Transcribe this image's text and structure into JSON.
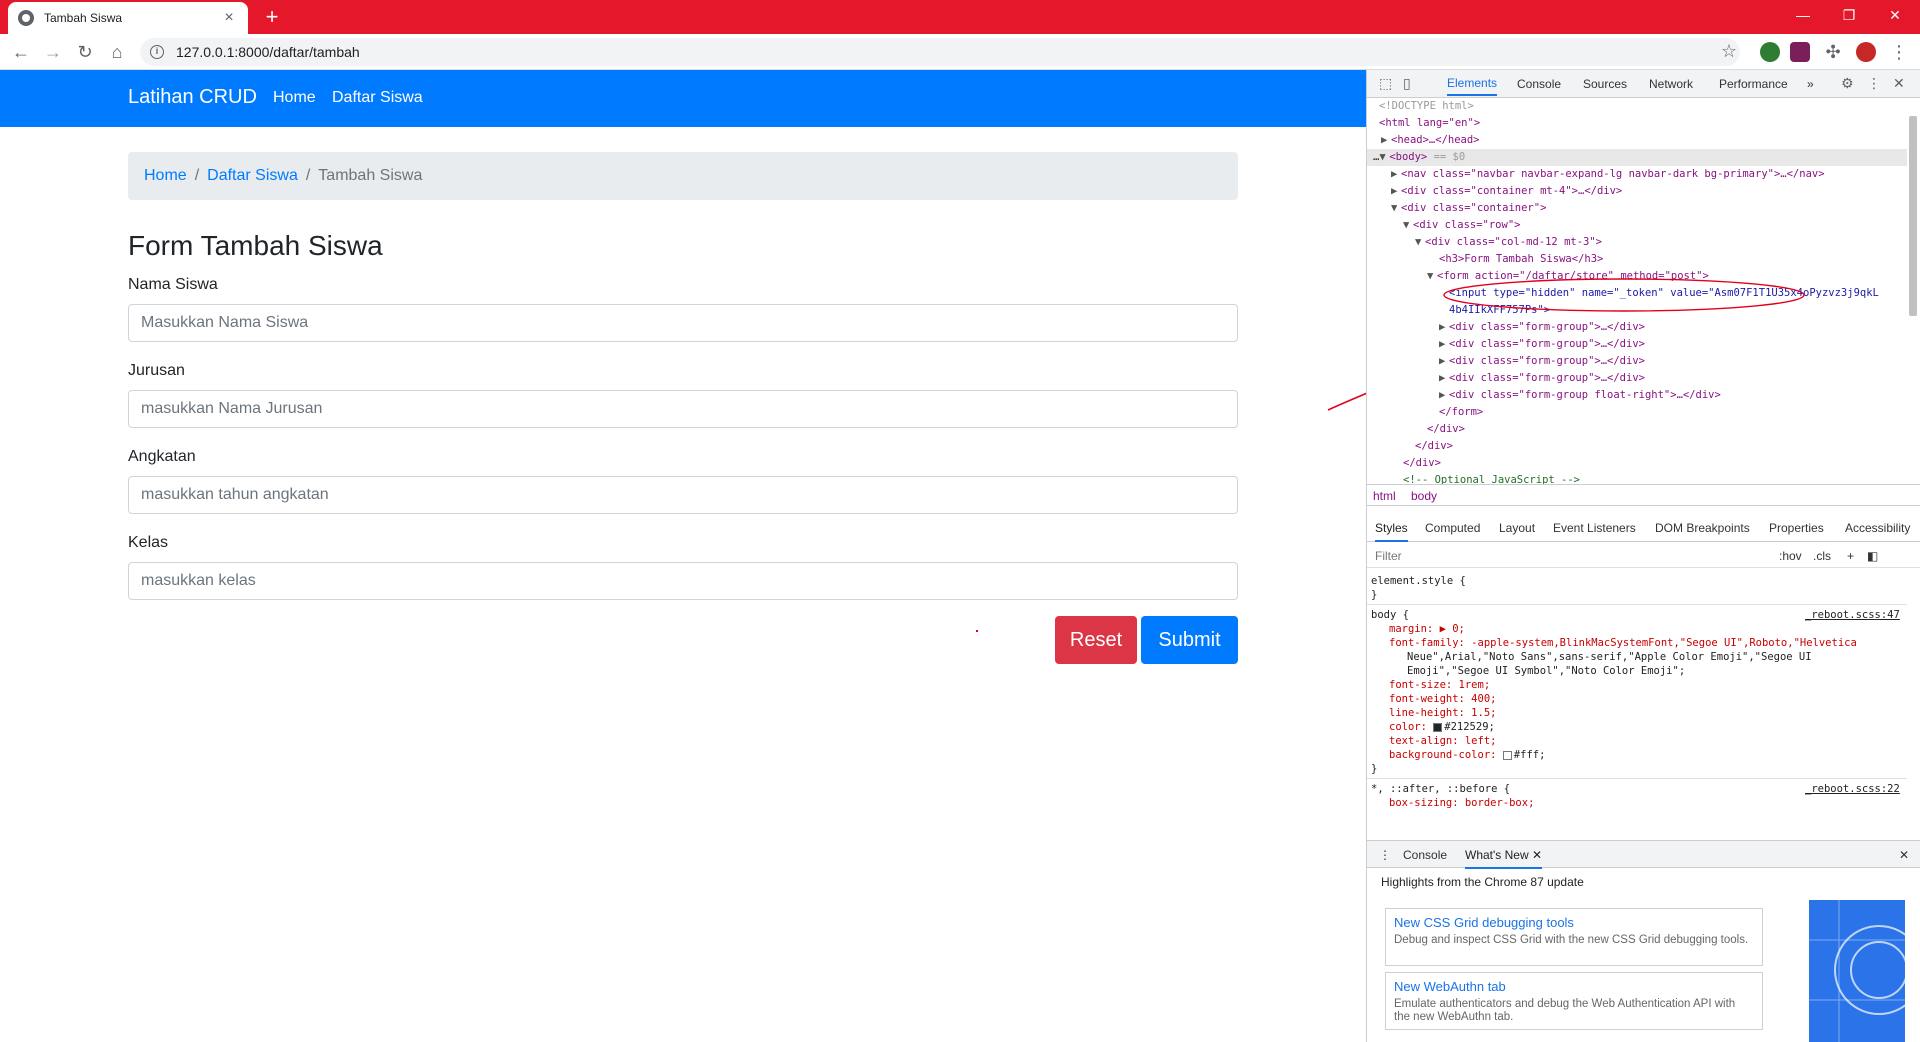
{
  "browser": {
    "tab_title": "Tambah Siswa",
    "new_tab": "+",
    "url": "127.0.0.1:8000/daftar/tambah",
    "controls": {
      "minimize": "—",
      "restore": "❐",
      "close": "✕"
    }
  },
  "navbar": {
    "brand": "Latihan CRUD",
    "links": [
      "Home",
      "Daftar Siswa"
    ]
  },
  "breadcrumb": {
    "items": [
      "Home",
      "Daftar Siswa"
    ],
    "separator": "/",
    "active": "Tambah Siswa"
  },
  "form": {
    "title": "Form Tambah Siswa",
    "fields": [
      {
        "label": "Nama Siswa",
        "placeholder": "Masukkan Nama Siswa"
      },
      {
        "label": "Jurusan",
        "placeholder": "masukkan Nama Jurusan"
      },
      {
        "label": "Angkatan",
        "placeholder": "masukkan tahun angkatan"
      },
      {
        "label": "Kelas",
        "placeholder": "masukkan kelas"
      }
    ],
    "reset_label": "Reset",
    "submit_label": "Submit"
  },
  "devtools": {
    "tabs": [
      "Elements",
      "Console",
      "Sources",
      "Network",
      "Performance"
    ],
    "more": "»",
    "dom": {
      "doctype": "<!DOCTYPE html>",
      "html_open": "<html lang=\"en\">",
      "head": "<head>…</head>",
      "body": "<body>",
      "body_marker": "== $0",
      "nav": "<nav class=\"navbar navbar-expand-lg navbar-dark bg-primary\">…</nav>",
      "container_mt4": "<div class=\"container mt-4\">…</div>",
      "container": "<div class=\"container\">",
      "row": "<div class=\"row\">",
      "col": "<div class=\"col-md-12 mt-3\">",
      "h3": "<h3>Form Tambah Siswa</h3>",
      "form_open": "<form action=\"/daftar/store\" method=\"post\">",
      "token_1": "<input type=\"hidden\" name=\"_token\" value=\"Asm07F1T1U35x4oPyzvz3j9qkL",
      "token_2": "4b4IIkXFF757Ps\">",
      "form_group": "<div class=\"form-group\">…</div>",
      "form_group_right": "<div class=\"form-group float-right\">…</div>",
      "form_close": "</form>",
      "div_close": "</div>",
      "comment": "<!-- Optional JavaScript -->"
    },
    "crumbs": [
      "html",
      "body"
    ],
    "sub_tabs": [
      "Styles",
      "Computed",
      "Layout",
      "Event Listeners",
      "DOM Breakpoints",
      "Properties",
      "Accessibility"
    ],
    "filter": {
      "placeholder": "Filter",
      "hov": ":hov",
      "cls": ".cls",
      "plus": "+"
    },
    "styles": {
      "element_style": "element.style {",
      "close": "}",
      "body_selector": "body {",
      "body_src": "_reboot.scss:47",
      "margin": "margin: ▶ 0;",
      "font_family_1": "font-family: -apple-system,BlinkMacSystemFont,\"Segoe UI\",Roboto,\"Helvetica",
      "font_family_2": "Neue\",Arial,\"Noto Sans\",sans-serif,\"Apple Color Emoji\",\"Segoe UI",
      "font_family_3": "Emoji\",\"Segoe UI Symbol\",\"Noto Color Emoji\";",
      "font_size": "font-size: 1rem;",
      "font_weight": "font-weight: 400;",
      "line_height": "line-height: 1.5;",
      "color": "#212529;",
      "color_prop": "color:",
      "text_align": "text-align: left;",
      "bg_prop": "background-color:",
      "bg_val": "#fff;",
      "after_selector": "*, ::after, ::before {",
      "after_src": "_reboot.scss:22",
      "box_sizing": "box-sizing: border-box;"
    },
    "drawer": {
      "tabs": [
        "Console",
        "What's New"
      ],
      "highlights": "Highlights from the Chrome 87 update",
      "cards": [
        {
          "title": "New CSS Grid debugging tools",
          "desc": "Debug and inspect CSS Grid with the new CSS Grid debugging tools."
        },
        {
          "title": "New WebAuthn tab",
          "desc": "Emulate authenticators and debug the Web Authentication API with the new WebAuthn tab."
        }
      ]
    }
  },
  "colors": {
    "chrome_tabstrip": "#e5182b",
    "navbar": "#007bff",
    "reset": "#dc3545",
    "submit": "#007bff",
    "annotation": "#e3001b"
  }
}
